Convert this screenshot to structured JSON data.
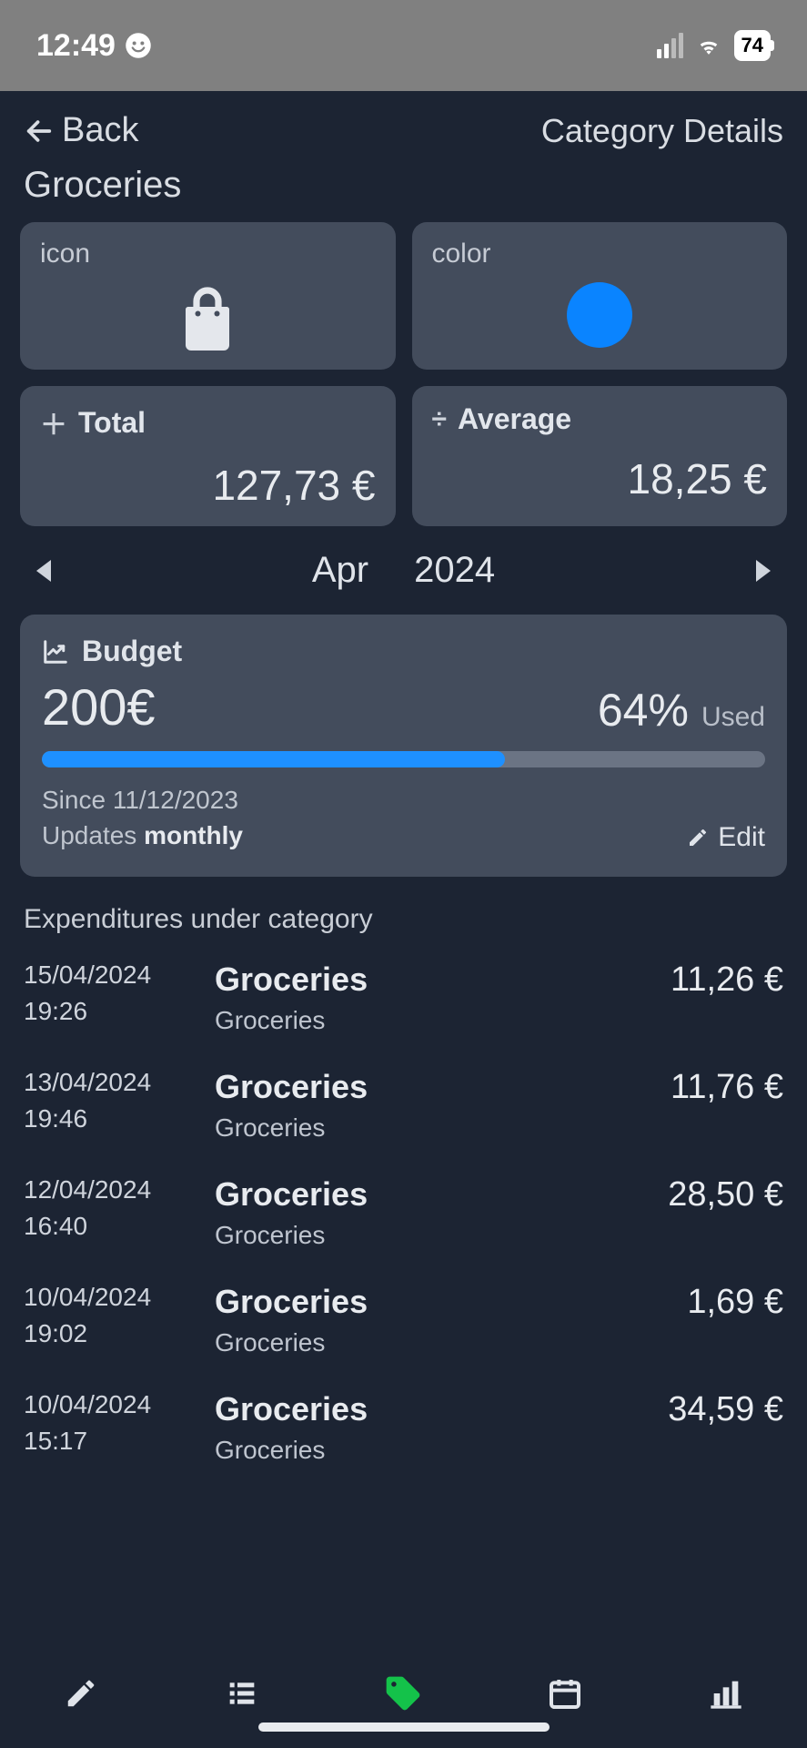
{
  "statusbar": {
    "time": "12:49",
    "battery": "74"
  },
  "nav": {
    "back_label": "Back",
    "title": "Category Details"
  },
  "category": {
    "name": "Groceries",
    "icon_label": "icon",
    "color_label": "color",
    "color_hex": "#0a84ff"
  },
  "stats": {
    "total_label": "Total",
    "total_value": "127,73 €",
    "avg_label": "Average",
    "avg_value": "18,25 €"
  },
  "period": {
    "month": "Apr",
    "year": "2024"
  },
  "budget": {
    "label": "Budget",
    "amount": "200€",
    "percent": "64%",
    "percent_num": 64,
    "used_label": "Used",
    "since_prefix": "Since ",
    "since_date": "11/12/2023",
    "updates_prefix": "Updates ",
    "updates_freq": "monthly",
    "edit_label": "Edit",
    "bar_color": "#1e90ff"
  },
  "tx_header": "Expenditures under category",
  "transactions": [
    {
      "date": "15/04/2024",
      "time": "19:26",
      "title": "Groceries",
      "sub": "Groceries",
      "amount": "11,26 €"
    },
    {
      "date": "13/04/2024",
      "time": "19:46",
      "title": "Groceries",
      "sub": "Groceries",
      "amount": "11,76 €"
    },
    {
      "date": "12/04/2024",
      "time": "16:40",
      "title": "Groceries",
      "sub": "Groceries",
      "amount": "28,50 €"
    },
    {
      "date": "10/04/2024",
      "time": "19:02",
      "title": "Groceries",
      "sub": "Groceries",
      "amount": "1,69 €"
    },
    {
      "date": "10/04/2024",
      "time": "15:17",
      "title": "Groceries",
      "sub": "Groceries",
      "amount": "34,59 €"
    }
  ]
}
